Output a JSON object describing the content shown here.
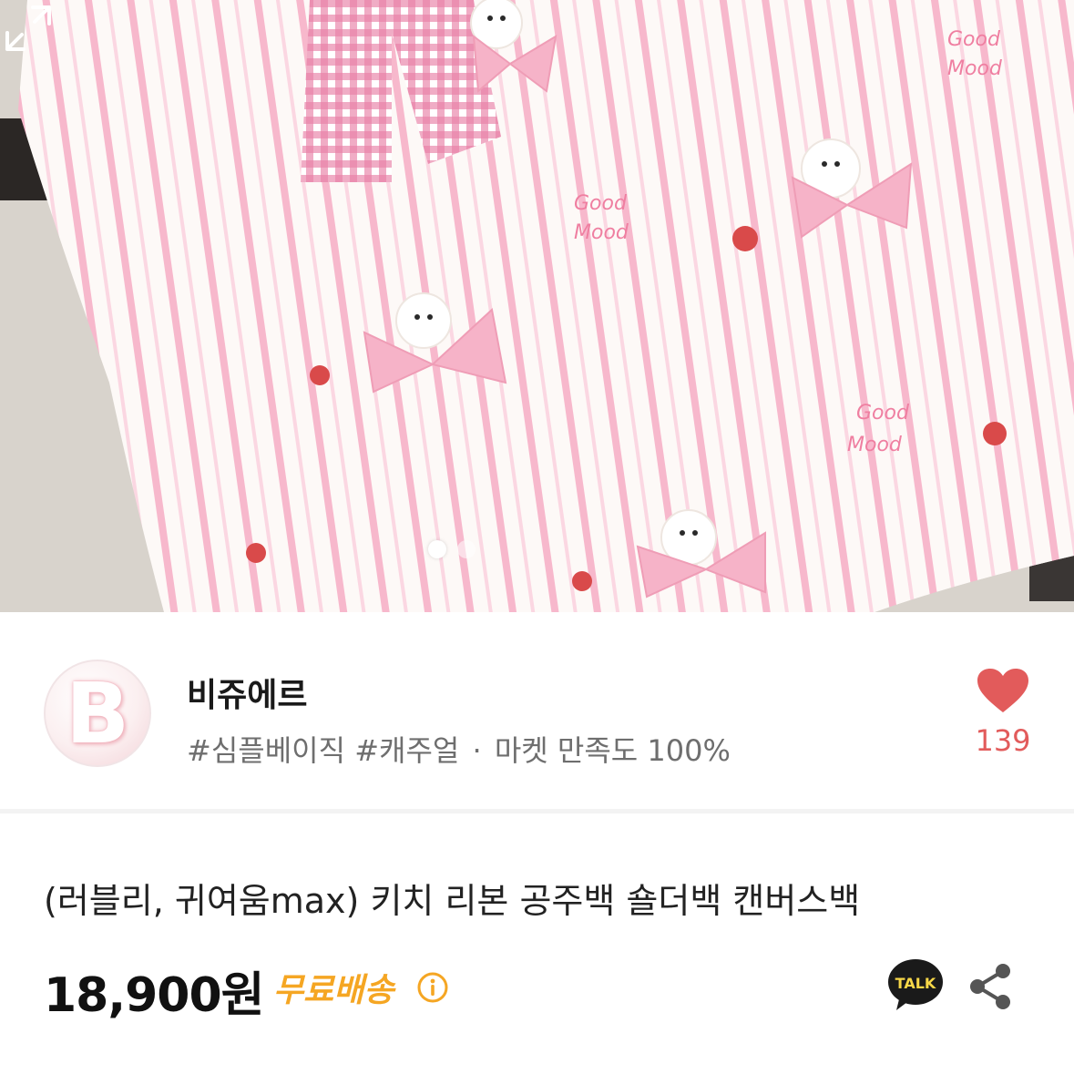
{
  "gallery": {
    "total_images": 2,
    "current_index": 1
  },
  "seller": {
    "logo_letter": "B",
    "name": "비쥬에르",
    "tag1": "#심플베이직",
    "tag2": "#캐주얼",
    "separator": "·",
    "satisfaction": "마켓 만족도 100%",
    "like_count": "139"
  },
  "product": {
    "title": "(러블리, 귀여움max) 키치 리본 공주백 숄더백 캔버스백",
    "price": "18,900원",
    "shipping": "무료배송",
    "talk_label": "TALK"
  },
  "colors": {
    "accent_heart": "#e25b5b",
    "shipping": "#f5a623",
    "talk_bg": "#1a1a1a",
    "talk_text": "#f7d748"
  },
  "icons": [
    "expand-icon",
    "heart-icon",
    "info-icon",
    "talk-icon",
    "share-icon"
  ]
}
